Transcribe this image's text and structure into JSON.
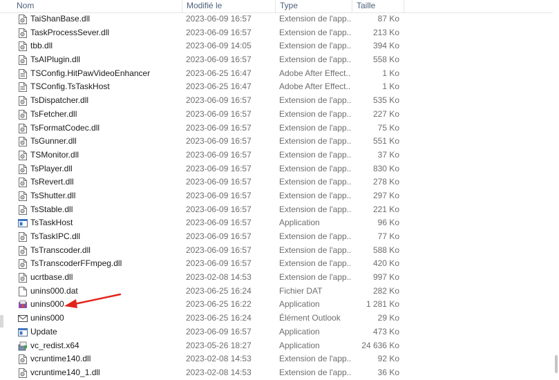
{
  "header": {
    "name": "Nom",
    "date": "Modifié le",
    "type": "Type",
    "size": "Taille"
  },
  "colors": {
    "arrow": "#e3241b",
    "header_text": "#4c607a",
    "secondary_text": "#6d6d6d"
  },
  "files": [
    {
      "name": "TaiShanBase.dll",
      "date": "2023-06-09 16:57",
      "type": "Extension de l'app...",
      "size": "87 Ko",
      "icon": "dll-file-icon"
    },
    {
      "name": "TaskProcessSever.dll",
      "date": "2023-06-09 16:57",
      "type": "Extension de l'app...",
      "size": "213 Ko",
      "icon": "dll-file-icon"
    },
    {
      "name": "tbb.dll",
      "date": "2023-06-09 14:05",
      "type": "Extension de l'app...",
      "size": "394 Ko",
      "icon": "dll-file-icon"
    },
    {
      "name": "TsAIPlugin.dll",
      "date": "2023-06-09 16:57",
      "type": "Extension de l'app...",
      "size": "558 Ko",
      "icon": "dll-file-icon"
    },
    {
      "name": "TSConfig.HitPawVideoEnhancer",
      "date": "2023-06-25 16:47",
      "type": "Adobe After Effect...",
      "size": "1 Ko",
      "icon": "text-file-icon"
    },
    {
      "name": "TSConfig.TsTaskHost",
      "date": "2023-06-25 16:47",
      "type": "Adobe After Effect...",
      "size": "1 Ko",
      "icon": "text-file-icon"
    },
    {
      "name": "TsDispatcher.dll",
      "date": "2023-06-09 16:57",
      "type": "Extension de l'app...",
      "size": "535 Ko",
      "icon": "dll-file-icon"
    },
    {
      "name": "TsFetcher.dll",
      "date": "2023-06-09 16:57",
      "type": "Extension de l'app...",
      "size": "227 Ko",
      "icon": "dll-file-icon"
    },
    {
      "name": "TsFormatCodec.dll",
      "date": "2023-06-09 16:57",
      "type": "Extension de l'app...",
      "size": "75 Ko",
      "icon": "dll-file-icon"
    },
    {
      "name": "TsGunner.dll",
      "date": "2023-06-09 16:57",
      "type": "Extension de l'app...",
      "size": "551 Ko",
      "icon": "dll-file-icon"
    },
    {
      "name": "TSMonitor.dll",
      "date": "2023-06-09 16:57",
      "type": "Extension de l'app...",
      "size": "37 Ko",
      "icon": "dll-file-icon"
    },
    {
      "name": "TsPlayer.dll",
      "date": "2023-06-09 16:57",
      "type": "Extension de l'app...",
      "size": "830 Ko",
      "icon": "dll-file-icon"
    },
    {
      "name": "TsRevert.dll",
      "date": "2023-06-09 16:57",
      "type": "Extension de l'app...",
      "size": "278 Ko",
      "icon": "dll-file-icon"
    },
    {
      "name": "TsShutter.dll",
      "date": "2023-06-09 16:57",
      "type": "Extension de l'app...",
      "size": "297 Ko",
      "icon": "dll-file-icon"
    },
    {
      "name": "TsStable.dll",
      "date": "2023-06-09 16:57",
      "type": "Extension de l'app...",
      "size": "221 Ko",
      "icon": "dll-file-icon"
    },
    {
      "name": "TsTaskHost",
      "date": "2023-06-09 16:57",
      "type": "Application",
      "size": "96 Ko",
      "icon": "application-icon"
    },
    {
      "name": "TsTaskIPC.dll",
      "date": "2023-06-09 16:57",
      "type": "Extension de l'app...",
      "size": "77 Ko",
      "icon": "dll-file-icon"
    },
    {
      "name": "TsTranscoder.dll",
      "date": "2023-06-09 16:57",
      "type": "Extension de l'app...",
      "size": "588 Ko",
      "icon": "dll-file-icon"
    },
    {
      "name": "TsTranscoderFFmpeg.dll",
      "date": "2023-06-09 16:57",
      "type": "Extension de l'app...",
      "size": "420 Ko",
      "icon": "dll-file-icon"
    },
    {
      "name": "ucrtbase.dll",
      "date": "2023-02-08 14:53",
      "type": "Extension de l'app...",
      "size": "997 Ko",
      "icon": "dll-file-icon"
    },
    {
      "name": "unins000.dat",
      "date": "2023-06-25 16:24",
      "type": "Fichier DAT",
      "size": "282 Ko",
      "icon": "blank-file-icon"
    },
    {
      "name": "unins000",
      "date": "2023-06-25 16:22",
      "type": "Application",
      "size": "1 281 Ko",
      "icon": "uninstaller-icon"
    },
    {
      "name": "unins000",
      "date": "2023-06-25 16:24",
      "type": "Élément Outlook",
      "size": "29 Ko",
      "icon": "mail-icon"
    },
    {
      "name": "Update",
      "date": "2023-06-09 16:57",
      "type": "Application",
      "size": "473 Ko",
      "icon": "application-icon"
    },
    {
      "name": "vc_redist.x64",
      "date": "2023-05-26 18:27",
      "type": "Application",
      "size": "24 636 Ko",
      "icon": "installer-icon"
    },
    {
      "name": "vcruntime140.dll",
      "date": "2023-02-08 14:53",
      "type": "Extension de l'app...",
      "size": "92 Ko",
      "icon": "dll-file-icon"
    },
    {
      "name": "vcruntime140_1.dll",
      "date": "2023-02-08 14:53",
      "type": "Extension de l'app...",
      "size": "36 Ko",
      "icon": "dll-file-icon"
    }
  ]
}
